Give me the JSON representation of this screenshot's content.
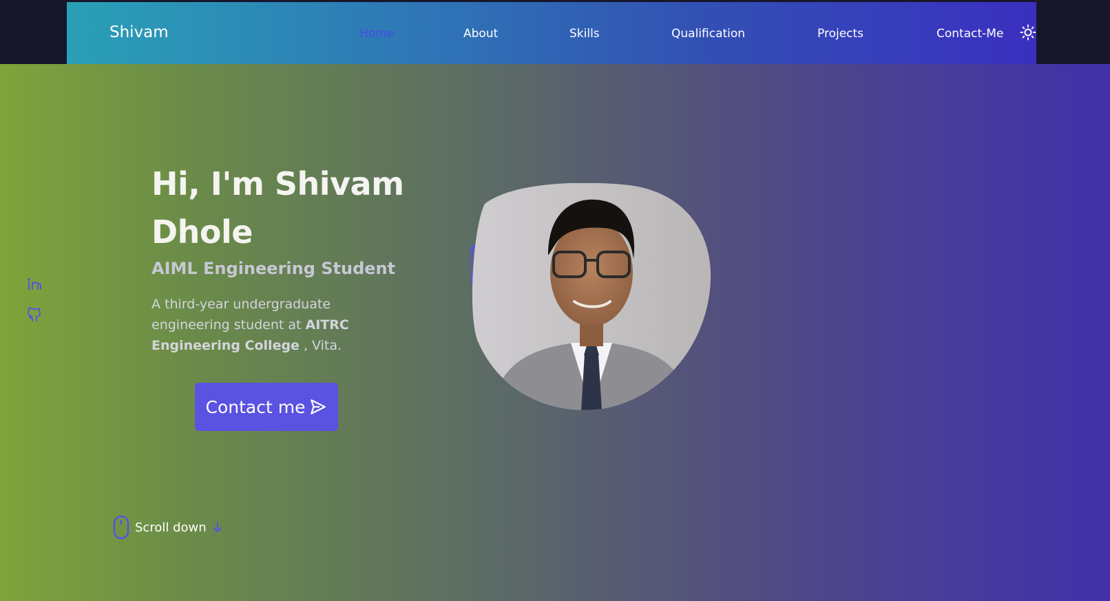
{
  "header": {
    "logo": "Shivam",
    "nav": [
      {
        "label": "Home",
        "active": true
      },
      {
        "label": "About"
      },
      {
        "label": "Skills"
      },
      {
        "label": "Qualification"
      },
      {
        "label": "Projects"
      },
      {
        "label": "Contact-Me"
      }
    ],
    "theme_icon": "sun-icon"
  },
  "socials": [
    {
      "icon": "linkedin-icon"
    },
    {
      "icon": "github-icon"
    }
  ],
  "hero": {
    "title": "Hi, I'm Shivam Dhole",
    "subtitle": "AIML Engineering Student",
    "description_pre": "A third-year undergraduate engineering student at ",
    "description_bold": "AITRC Engineering College",
    "description_post": " , Vita.",
    "cta_label": "Contact me",
    "cta_icon": "send-icon"
  },
  "scroll": {
    "label": "Scroll down",
    "icons": [
      "mouse-icon",
      "arrow-down-icon"
    ]
  },
  "colors": {
    "accent": "#5a52e0",
    "nav_active": "#4b49e6",
    "top_strip": "#17162a"
  }
}
